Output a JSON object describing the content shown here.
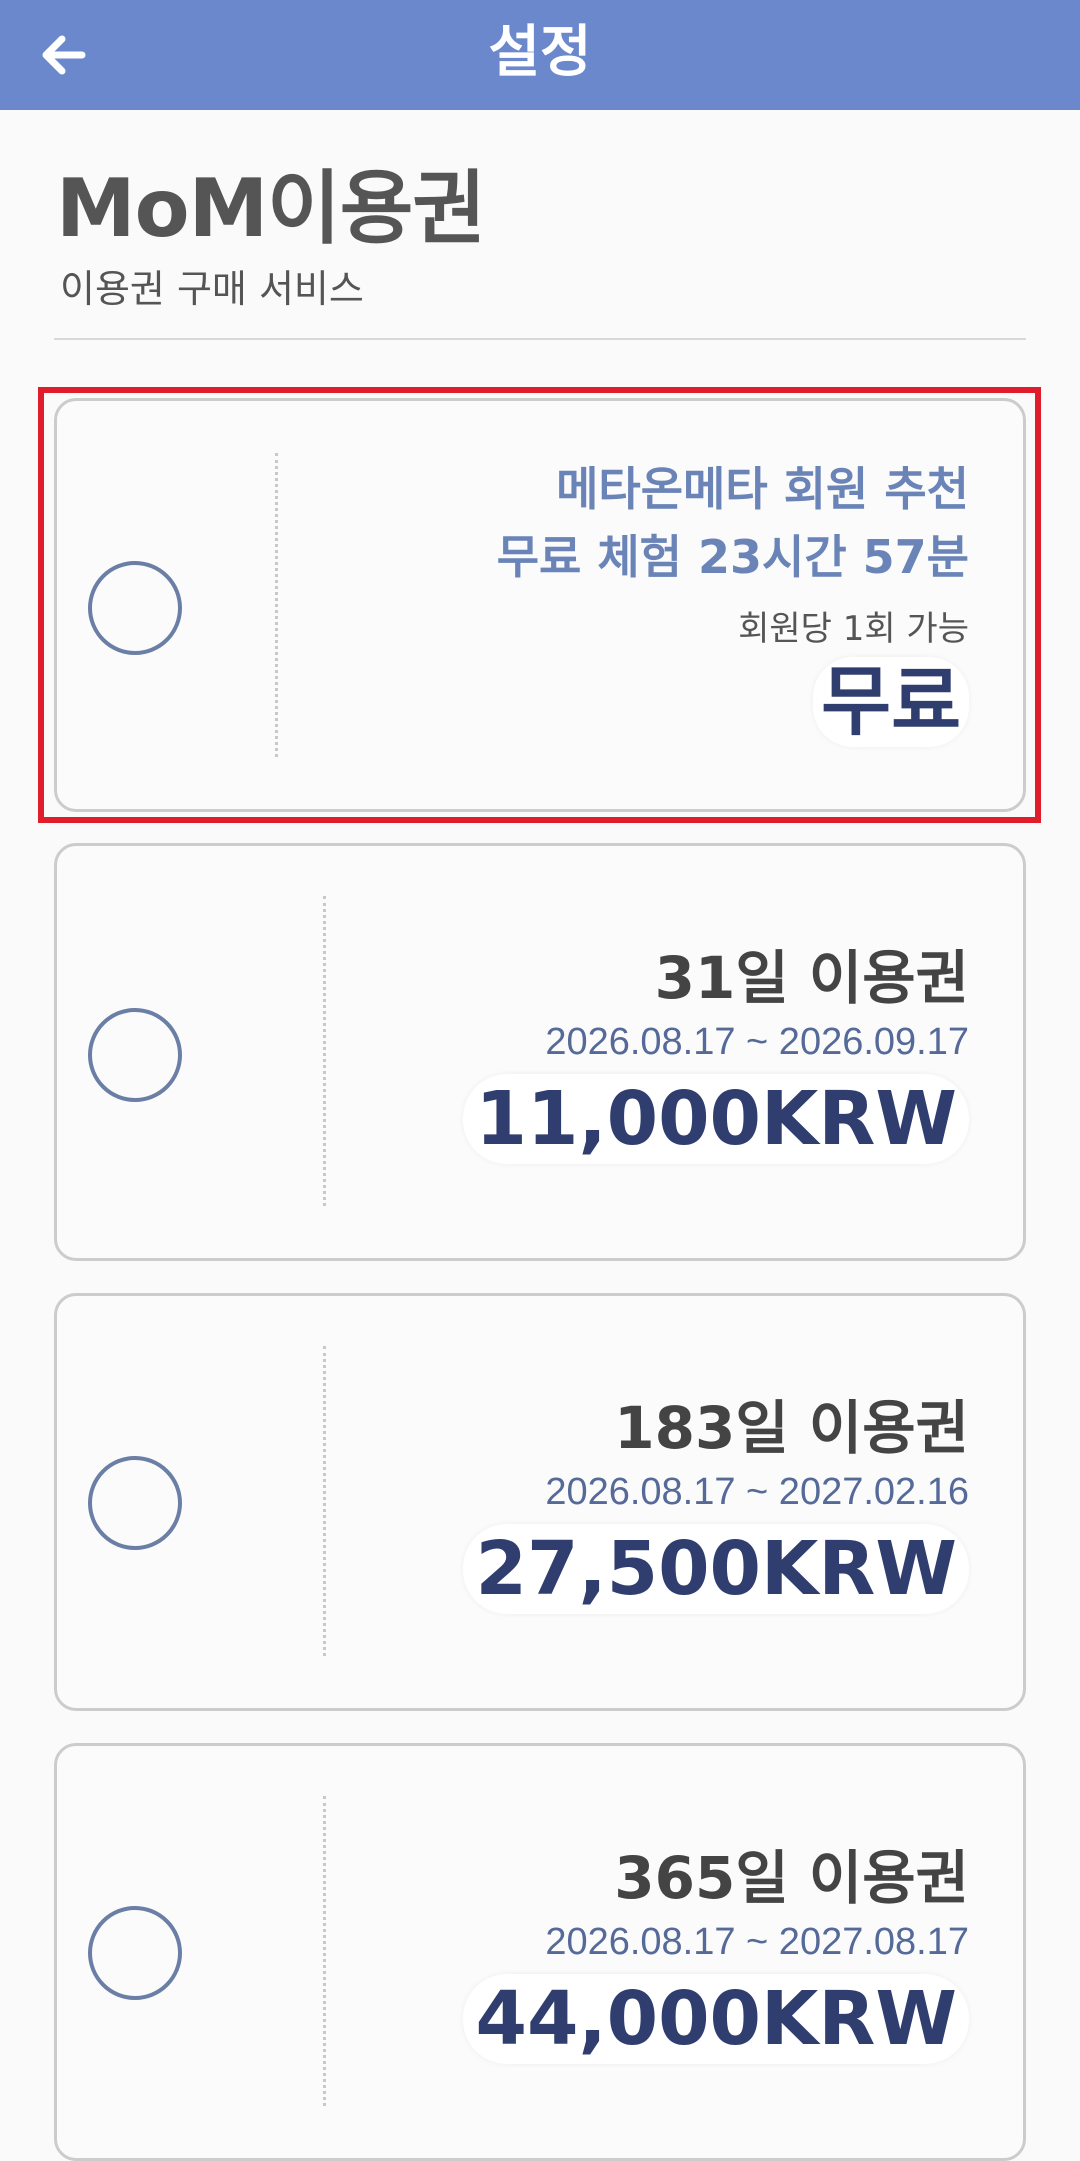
{
  "header": {
    "title": "설정",
    "back_icon": "arrow-left-icon"
  },
  "page": {
    "title": "MoM이용권",
    "subtitle": "이용권 구매 서비스"
  },
  "colors": {
    "header_bg": "#6b88cc",
    "accent_text": "#6a84b8",
    "price_text": "#2f3e6e",
    "highlight_border": "#e01e2b"
  },
  "free_plan": {
    "line1": "메타온메타 회원 추천",
    "line2": "무료 체험 23시간 57분",
    "note": "회원당 1회 가능",
    "price": "무료",
    "selected": false
  },
  "plans": [
    {
      "name": "31일 이용권",
      "dates": "2026.08.17 ~ 2026.09.17",
      "price": "11,000KRW",
      "selected": false
    },
    {
      "name": "183일 이용권",
      "dates": "2026.08.17 ~ 2027.02.16",
      "price": "27,500KRW",
      "selected": false
    },
    {
      "name": "365일 이용권",
      "dates": "2026.08.17 ~ 2027.08.17",
      "price": "44,000KRW",
      "selected": false
    }
  ]
}
